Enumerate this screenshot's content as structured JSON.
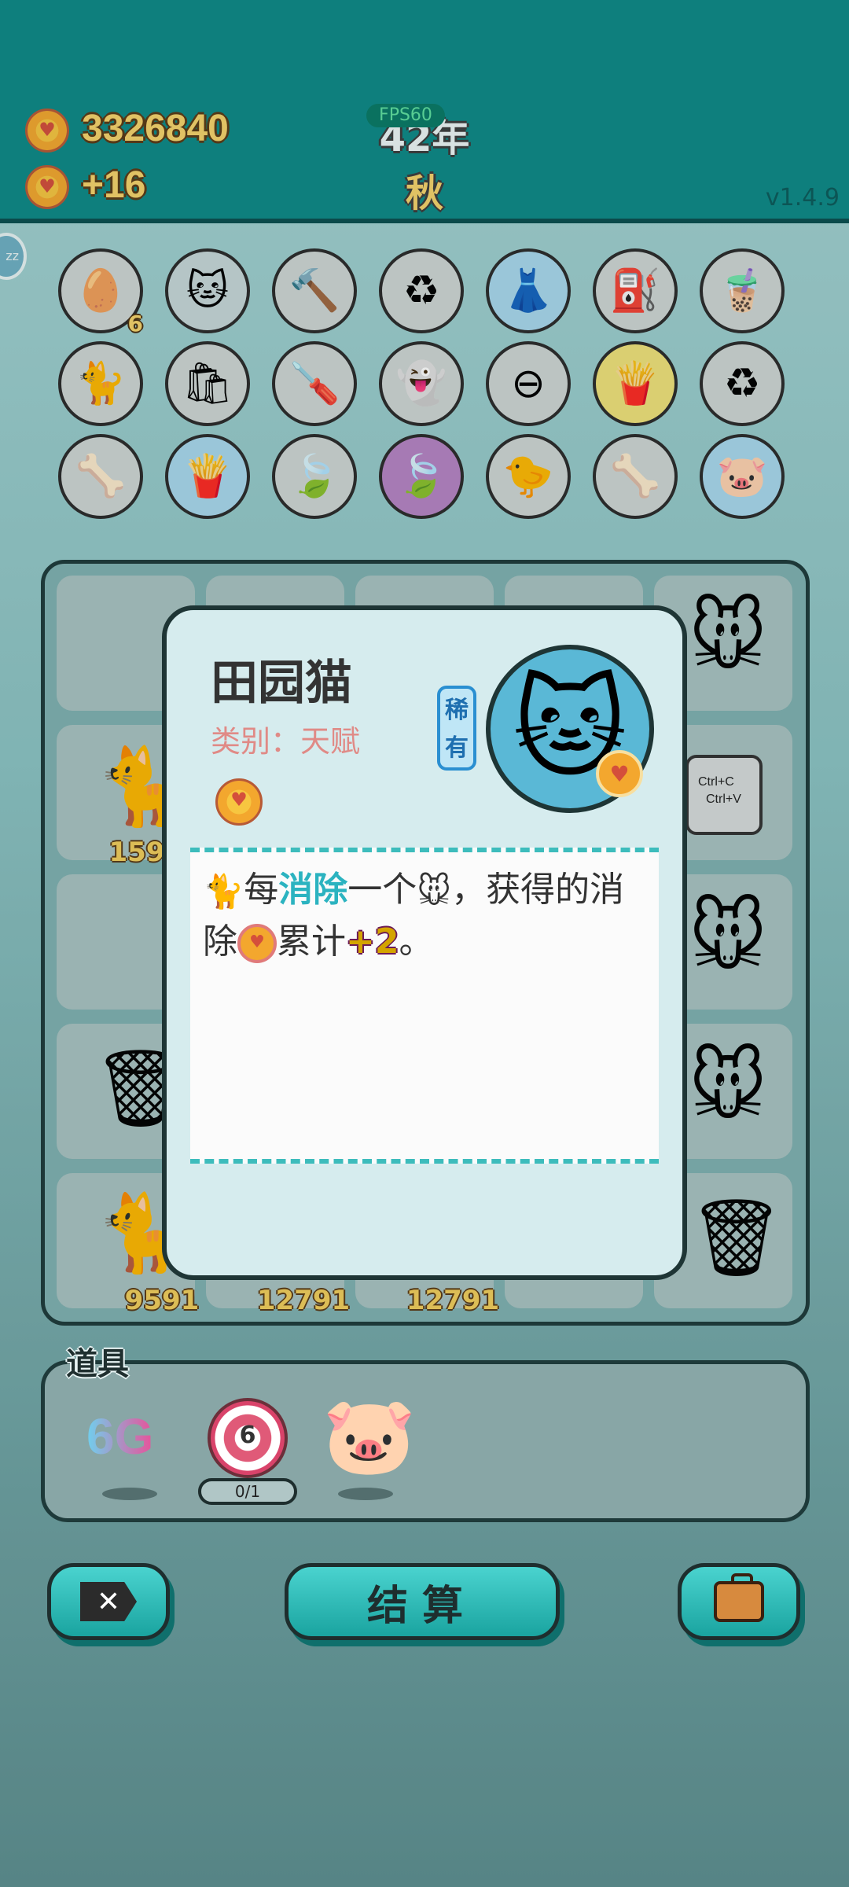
{
  "header": {
    "coins_total": "3326840",
    "coins_gain": "+16",
    "year": "42年",
    "season": "秋",
    "fps": "FPS60",
    "version": "v1.4.9",
    "side_badge": "zz"
  },
  "relics": [
    {
      "icon": "egg-carton-icon",
      "glyph": "🥚",
      "count": "6",
      "bg": "#cfd6d4"
    },
    {
      "icon": "cat-icon",
      "glyph": "🐱",
      "bg": "#c7d7d9"
    },
    {
      "icon": "hammer-icon",
      "glyph": "🔨",
      "bg": "#cfd6d4"
    },
    {
      "icon": "recycle-icon",
      "glyph": "♻",
      "bg": "#cfd6d4"
    },
    {
      "icon": "skirt-icon",
      "glyph": "👗",
      "bg": "#a9d9ee"
    },
    {
      "icon": "pump-icon",
      "glyph": "⛽",
      "bg": "#cfd6d4"
    },
    {
      "icon": "bubble-tea-icon",
      "glyph": "🧋",
      "bg": "#cfd6d4"
    },
    {
      "icon": "twin-cats-icon",
      "glyph": "🐈",
      "bg": "#cfd6d4"
    },
    {
      "icon": "recycle-bag-icon",
      "glyph": "🛍",
      "bg": "#cfd6d4"
    },
    {
      "icon": "screwdriver-icon",
      "glyph": "🪛",
      "bg": "#cfd6d4"
    },
    {
      "icon": "ghost-icon",
      "glyph": "👻",
      "bg": "#cfd6d4"
    },
    {
      "icon": "minus-icon",
      "glyph": "⊖",
      "bg": "#cfd6d4"
    },
    {
      "icon": "fries-icon",
      "glyph": "🍟",
      "bg": "#f0e37a"
    },
    {
      "icon": "recycle-icon",
      "glyph": "♻",
      "bg": "#cfd6d4"
    },
    {
      "icon": "pet-food-icon",
      "glyph": "🦴",
      "bg": "#cfd6d4"
    },
    {
      "icon": "fries-icon",
      "glyph": "🍟",
      "bg": "#a9d9ee"
    },
    {
      "icon": "leaf-icon",
      "glyph": "🍃",
      "bg": "#cfd6d4"
    },
    {
      "icon": "leaf-icon",
      "glyph": "🍃",
      "bg": "#b684c4"
    },
    {
      "icon": "chick-icon",
      "glyph": "🐤",
      "bg": "#cfd6d4"
    },
    {
      "icon": "pet-food-icon",
      "glyph": "🦴",
      "bg": "#cfd6d4"
    },
    {
      "icon": "piggy-bank-icon",
      "glyph": "🐷",
      "bg": "#a9d9ee"
    }
  ],
  "board": {
    "values": {
      "r2c1": "159",
      "r5c1": "9591",
      "r5c2": "12791",
      "r5c3": "12791"
    },
    "ctrl_card": {
      "line1": "Ctrl+C",
      "line2": "Ctrl+V"
    }
  },
  "card": {
    "name": "田园猫",
    "category": "类别：天赋",
    "rarity": "稀有",
    "desc_part1": "每",
    "desc_keyword": "消除",
    "desc_part2": "一个",
    "desc_part3": "，获得的消除",
    "desc_part4": "累计",
    "desc_plus": "+2",
    "desc_end": "。"
  },
  "items": {
    "title": "道具",
    "gg_label": "6G",
    "target_value": "6",
    "target_uses": "0/1"
  },
  "buttons": {
    "settle": "结算"
  },
  "colors": {
    "topbar": "#0d8a87",
    "accent": "#2bb3c0",
    "coin": "#f3a72e"
  }
}
